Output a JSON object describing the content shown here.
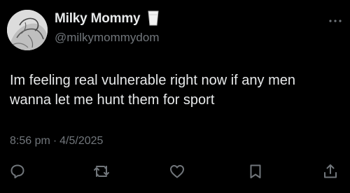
{
  "author": {
    "display_name": "Milky Mommy",
    "handle": "@milkymommydom"
  },
  "tweet": {
    "text": "Im feeling real vulnerable right now if any men\nwanna let me hunt them for sport",
    "time": "8:56 pm",
    "separator": "·",
    "date": "4/5/2025"
  },
  "icons": {
    "name_emoji": "milk-glass-icon",
    "more": "more-dots-icon",
    "reply": "reply-icon",
    "retweet": "retweet-icon",
    "like": "heart-icon",
    "bookmark": "bookmark-icon",
    "share": "share-icon"
  },
  "colors": {
    "background": "#000000",
    "primary_text": "#e7e9ea",
    "secondary_text": "#71767b"
  }
}
